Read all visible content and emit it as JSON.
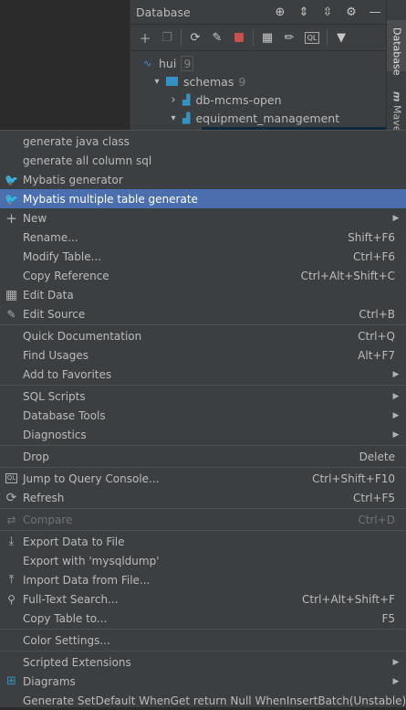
{
  "panel": {
    "title": "Database",
    "header_icons": [
      "target-icon",
      "expand-all-icon",
      "collapse-all-icon",
      "gear-icon",
      "minimize-icon"
    ],
    "toolbar_icons": [
      "add-icon",
      "copy-icon",
      "refresh-icon",
      "properties-icon",
      "stop-icon",
      "table-icon",
      "edit-icon",
      "console-icon",
      "filter-icon"
    ],
    "tree": [
      {
        "label": "hui",
        "count": "9",
        "level": 0,
        "arrow": "",
        "icon": "datasource-icon"
      },
      {
        "label": "schemas",
        "count": "9",
        "level": 1,
        "arrow": "▾",
        "icon": "folder-icon"
      },
      {
        "label": "db-mcms-open",
        "count": "",
        "level": 2,
        "arrow": "›",
        "icon": "schema-icon"
      },
      {
        "label": "equipment_management",
        "count": "",
        "level": 2,
        "arrow": "▾",
        "icon": "schema-icon"
      }
    ],
    "side_tabs": [
      "Database",
      "Maven"
    ]
  },
  "menu": {
    "items": [
      {
        "label": "generate java class",
        "shortcut": "",
        "icon": "",
        "submenu": false
      },
      {
        "label": "generate all column sql",
        "shortcut": "",
        "icon": "",
        "submenu": false
      },
      {
        "label": "Mybatis generator",
        "shortcut": "",
        "icon": "mybatis-bird-icon",
        "submenu": false
      },
      {
        "label": "Mybatis multiple table generate",
        "shortcut": "",
        "icon": "mybatis-bird-icon",
        "submenu": false,
        "highlighted": true
      },
      {
        "label": "New",
        "shortcut": "",
        "icon": "plus-icon",
        "submenu": true
      },
      {
        "label": "Rename...",
        "shortcut": "Shift+F6",
        "icon": "",
        "submenu": false
      },
      {
        "label": "Modify Table...",
        "shortcut": "Ctrl+F6",
        "icon": "",
        "submenu": false
      },
      {
        "label": "Copy Reference",
        "shortcut": "Ctrl+Alt+Shift+C",
        "icon": "",
        "submenu": false
      },
      {
        "label": "Edit Data",
        "shortcut": "",
        "icon": "table-grid-icon",
        "submenu": false
      },
      {
        "label": "Edit Source",
        "shortcut": "Ctrl+B",
        "icon": "pencil-icon",
        "submenu": false
      },
      {
        "sep": true
      },
      {
        "label": "Quick Documentation",
        "shortcut": "Ctrl+Q",
        "icon": "",
        "submenu": false
      },
      {
        "label": "Find Usages",
        "shortcut": "Alt+F7",
        "icon": "",
        "submenu": false
      },
      {
        "label": "Add to Favorites",
        "shortcut": "",
        "icon": "",
        "submenu": true
      },
      {
        "sep": true
      },
      {
        "label": "SQL Scripts",
        "shortcut": "",
        "icon": "",
        "submenu": true
      },
      {
        "label": "Database Tools",
        "shortcut": "",
        "icon": "",
        "submenu": true
      },
      {
        "label": "Diagnostics",
        "shortcut": "",
        "icon": "",
        "submenu": true
      },
      {
        "sep": true
      },
      {
        "label": "Drop",
        "shortcut": "Delete",
        "icon": "",
        "submenu": false
      },
      {
        "sep": true
      },
      {
        "label": "Jump to Query Console...",
        "shortcut": "Ctrl+Shift+F10",
        "icon": "console-icon",
        "submenu": false
      },
      {
        "label": "Refresh",
        "shortcut": "Ctrl+F5",
        "icon": "refresh-icon",
        "submenu": false
      },
      {
        "sep": true
      },
      {
        "label": "Compare",
        "shortcut": "Ctrl+D",
        "icon": "compare-icon",
        "submenu": false,
        "disabled": true
      },
      {
        "sep": true
      },
      {
        "label": "Export Data to File",
        "shortcut": "",
        "icon": "export-icon",
        "submenu": false
      },
      {
        "label": "Export with 'mysqldump'",
        "shortcut": "",
        "icon": "",
        "submenu": false
      },
      {
        "label": "Import Data from File...",
        "shortcut": "",
        "icon": "import-icon",
        "submenu": false
      },
      {
        "label": "Full-Text Search...",
        "shortcut": "Ctrl+Alt+Shift+F",
        "icon": "search-icon",
        "submenu": false
      },
      {
        "label": "Copy Table to...",
        "shortcut": "F5",
        "icon": "",
        "submenu": false
      },
      {
        "sep": true
      },
      {
        "label": "Color Settings...",
        "shortcut": "",
        "icon": "",
        "submenu": false
      },
      {
        "sep": true
      },
      {
        "label": "Scripted Extensions",
        "shortcut": "",
        "icon": "",
        "submenu": true
      },
      {
        "label": "Diagrams",
        "shortcut": "",
        "icon": "diagram-icon",
        "submenu": true
      },
      {
        "label": "Generate SetDefault WhenGet return Null WhenInsertBatch(Unstable)",
        "shortcut": "",
        "icon": "",
        "submenu": false
      }
    ]
  },
  "colors": {
    "background": "#3c3f41",
    "highlight": "#4b6eaf",
    "text": "#bbbbbb",
    "disabled": "#6f7173",
    "stop_red": "#c94f4f",
    "folder_blue": "#3592c4"
  }
}
